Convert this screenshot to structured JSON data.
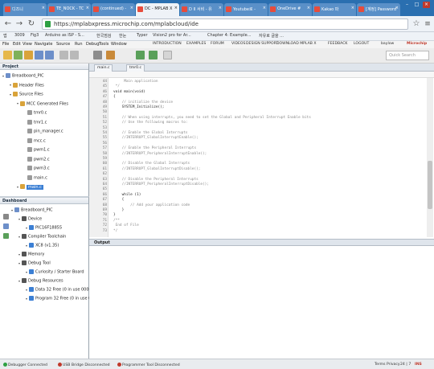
{
  "browser": {
    "tabs": [
      {
        "label": "디즈니 "
      },
      {
        "label": "TE_NOCK - TC"
      },
      {
        "label": "(continued) - "
      },
      {
        "label": "DC - MPLAB X"
      },
      {
        "label": "D II 서비 - 유"
      },
      {
        "label": "Youtube로 -"
      },
      {
        "label": "OneDrive #"
      },
      {
        "label": "Kakao 파"
      },
      {
        "label": "[계정] Password"
      }
    ],
    "url": "https://mplabxpress.microchip.com/mplabcloud/ide",
    "bookmarks": [
      "앱",
      "3009",
      "Fig3",
      "Arduino as ISP - S...",
      "한국점검",
      "한눈",
      "Typer",
      "Vision2 pro for Ar...",
      "Chapter 4: Example...",
      "자유로 글을 ..."
    ]
  },
  "ide_menu": {
    "items": [
      "File",
      "Edit",
      "View",
      "Navigate",
      "Source",
      "Run",
      "Debug",
      "Tools",
      "Window"
    ],
    "links": [
      "INTRODUCTION",
      "EXAMPLES",
      "FORUM",
      "VIDEOS",
      "DESIGN SUPPORT",
      "DOWNLOAD MPLAB X",
      "FEEDBACK",
      "LOGOUT"
    ],
    "user": "baylow",
    "brand": "Microchip"
  },
  "search": {
    "placeholder": "Quick Search"
  },
  "projects_panel": {
    "title": "Project",
    "tree": [
      {
        "label": "Breadboard_PIC",
        "depth": 0
      },
      {
        "label": "Header Files",
        "depth": 1
      },
      {
        "label": "Source Files",
        "depth": 1
      },
      {
        "label": "MCC Generated Files",
        "depth": 2
      },
      {
        "label": "tmr0.c",
        "depth": 3
      },
      {
        "label": "tmr1.c",
        "depth": 3
      },
      {
        "label": "pin_manager.c",
        "depth": 3
      },
      {
        "label": "mcc.c",
        "depth": 3
      },
      {
        "label": "pwm1.c",
        "depth": 3
      },
      {
        "label": "pwm2.c",
        "depth": 3
      },
      {
        "label": "pwm3.c",
        "depth": 3
      },
      {
        "label": "main.c",
        "depth": 3
      },
      {
        "label": "main.c",
        "depth": 2,
        "selected": true
      }
    ]
  },
  "dashboard_panel": {
    "title": "Dashboard",
    "tree": [
      {
        "label": "Breadboard_PIC",
        "depth": 0
      },
      {
        "label": "Device",
        "depth": 1
      },
      {
        "label": "PIC16F18855",
        "depth": 2
      },
      {
        "label": "Compiler Toolchain",
        "depth": 1
      },
      {
        "label": "XC8 (v1.35)",
        "depth": 2
      },
      {
        "label": "Memory",
        "depth": 1
      },
      {
        "label": "Debug Tool",
        "depth": 1
      },
      {
        "label": "Curiosity / Starter Board",
        "depth": 2
      },
      {
        "label": "Debug Resources",
        "depth": 1
      },
      {
        "label": "Data 32 Free (0 in use 0000)",
        "depth": 2
      },
      {
        "label": "Program 32 Free (0 in use 0000)",
        "depth": 2
      }
    ]
  },
  "editor": {
    "tabs": [
      "main.c",
      "tmr0.c"
    ],
    "lines": [
      {
        "n": "44",
        "text": "     Main application",
        "kind": "comment"
      },
      {
        "n": "45",
        "text": " */",
        "kind": "comment"
      },
      {
        "n": "46",
        "text": "void main(void)",
        "kind": "code"
      },
      {
        "n": "47",
        "text": "{",
        "kind": "code"
      },
      {
        "n": "48",
        "text": "    // initialize the device",
        "kind": "comment"
      },
      {
        "n": "49",
        "text": "    SYSTEM_Initialize();",
        "kind": "code"
      },
      {
        "n": "50",
        "text": "",
        "kind": "code"
      },
      {
        "n": "51",
        "text": "    // When using interrupts, you need to set the Global and Peripheral Interrupt Enable bits",
        "kind": "comment"
      },
      {
        "n": "52",
        "text": "    // Use the following macros to:",
        "kind": "comment"
      },
      {
        "n": "53",
        "text": "",
        "kind": "code"
      },
      {
        "n": "54",
        "text": "    // Enable the Global Interrupts",
        "kind": "comment"
      },
      {
        "n": "55",
        "text": "    //INTERRUPT_GlobalInterruptEnable();",
        "kind": "comment"
      },
      {
        "n": "56",
        "text": "",
        "kind": "code"
      },
      {
        "n": "57",
        "text": "    // Enable the Peripheral Interrupts",
        "kind": "comment"
      },
      {
        "n": "58",
        "text": "    //INTERRUPT_PeripheralInterruptEnable();",
        "kind": "comment"
      },
      {
        "n": "59",
        "text": "",
        "kind": "code"
      },
      {
        "n": "60",
        "text": "    // Disable the Global Interrupts",
        "kind": "comment"
      },
      {
        "n": "61",
        "text": "    //INTERRUPT_GlobalInterruptDisable();",
        "kind": "comment"
      },
      {
        "n": "62",
        "text": "",
        "kind": "code"
      },
      {
        "n": "63",
        "text": "    // Disable the Peripheral Interrupts",
        "kind": "comment"
      },
      {
        "n": "64",
        "text": "    //INTERRUPT_PeripheralInterruptDisable();",
        "kind": "comment"
      },
      {
        "n": "65",
        "text": "",
        "kind": "code"
      },
      {
        "n": "66",
        "text": "    while (1)",
        "kind": "code"
      },
      {
        "n": "67",
        "text": "    {",
        "kind": "code"
      },
      {
        "n": "68",
        "text": "        // Add your application code",
        "kind": "comment"
      },
      {
        "n": "69",
        "text": "    }",
        "kind": "code"
      },
      {
        "n": "70",
        "text": "}",
        "kind": "code"
      },
      {
        "n": "71",
        "text": "/**",
        "kind": "comment"
      },
      {
        "n": "72",
        "text": " End of File",
        "kind": "comment"
      },
      {
        "n": "73",
        "text": "*/",
        "kind": "comment"
      }
    ]
  },
  "output_panel": {
    "title": "Output"
  },
  "status": {
    "debugger": "Debugger Connected",
    "bridge": "USB Bridge Disconnected",
    "programmer": "Programmer Tool Disconnected",
    "right_label": "Terms Privacy",
    "position": "24 | 7",
    "insert": "INS"
  },
  "colors": {
    "accent": "#2a6fb0",
    "selection": "#3b7fd4",
    "comment": "#8a8a8a"
  }
}
